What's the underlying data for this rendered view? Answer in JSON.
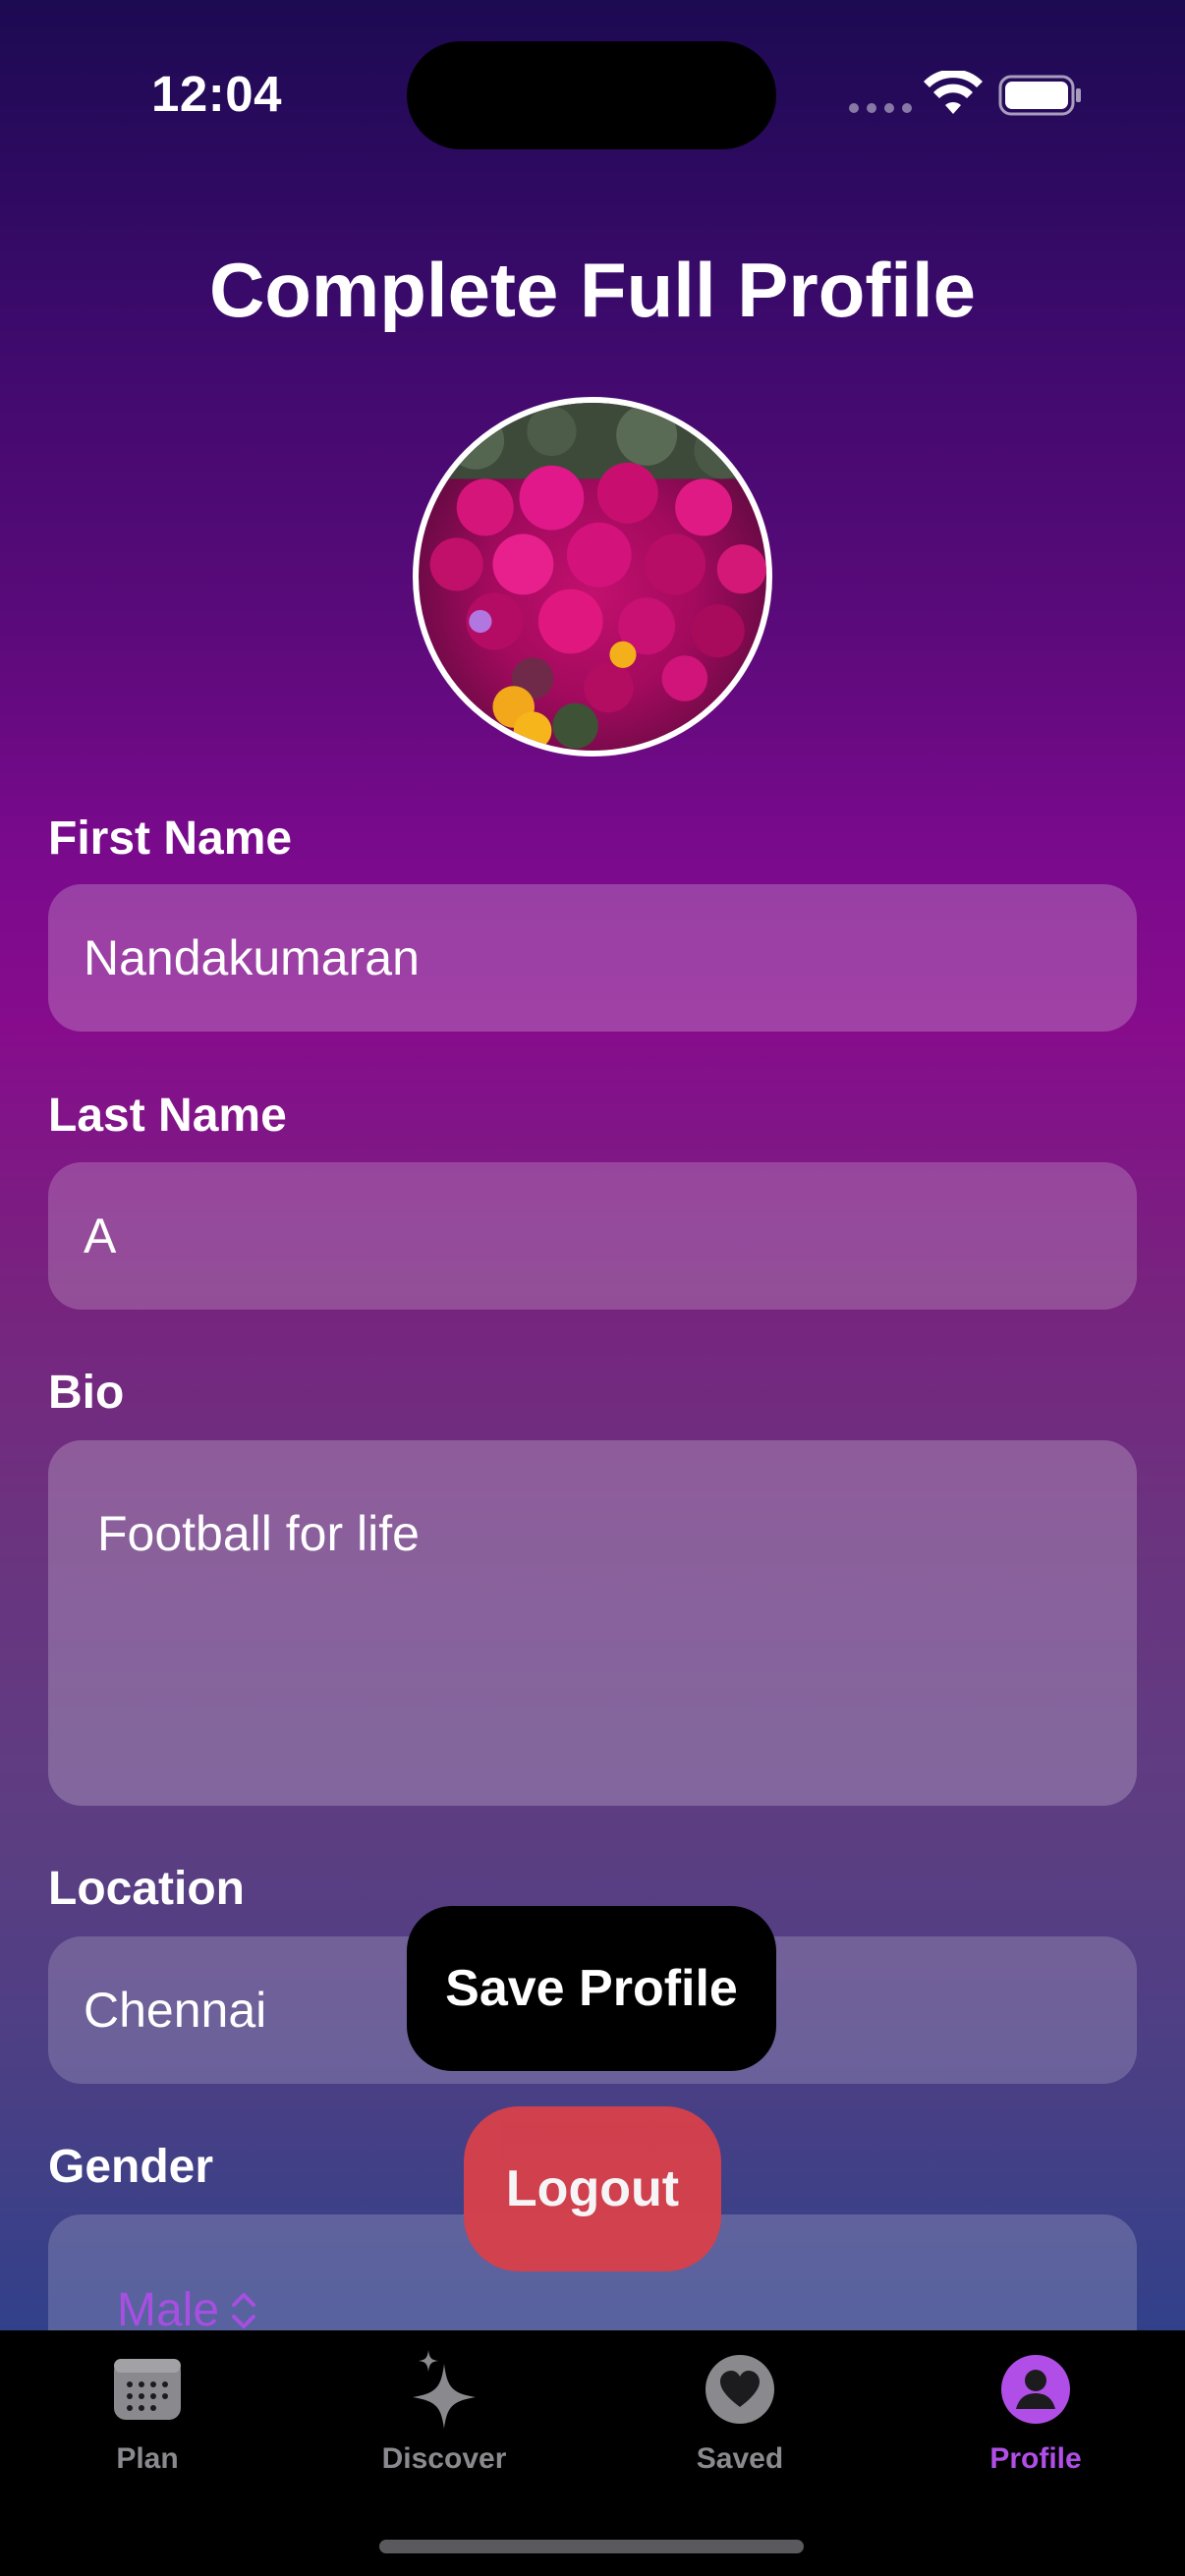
{
  "status_bar": {
    "time": "12:04"
  },
  "page": {
    "title": "Complete Full Profile"
  },
  "form": {
    "first_name": {
      "label": "First Name",
      "value": "Nandakumaran"
    },
    "last_name": {
      "label": "Last Name",
      "value": "A"
    },
    "bio": {
      "label": "Bio",
      "value": "Football for life"
    },
    "location": {
      "label": "Location",
      "value": "Chennai"
    },
    "gender": {
      "label": "Gender",
      "value": "Male"
    }
  },
  "actions": {
    "save_label": "Save Profile",
    "logout_label": "Logout"
  },
  "tab_bar": {
    "tabs": [
      {
        "label": "Plan",
        "icon": "calendar-icon"
      },
      {
        "label": "Discover",
        "icon": "sparkles-icon"
      },
      {
        "label": "Saved",
        "icon": "heart-icon"
      },
      {
        "label": "Profile",
        "icon": "person-icon",
        "active": true
      }
    ]
  },
  "colors": {
    "accent": "#b14ee8",
    "logout": "#d8404a",
    "tab_inactive": "#8a8a8e"
  }
}
